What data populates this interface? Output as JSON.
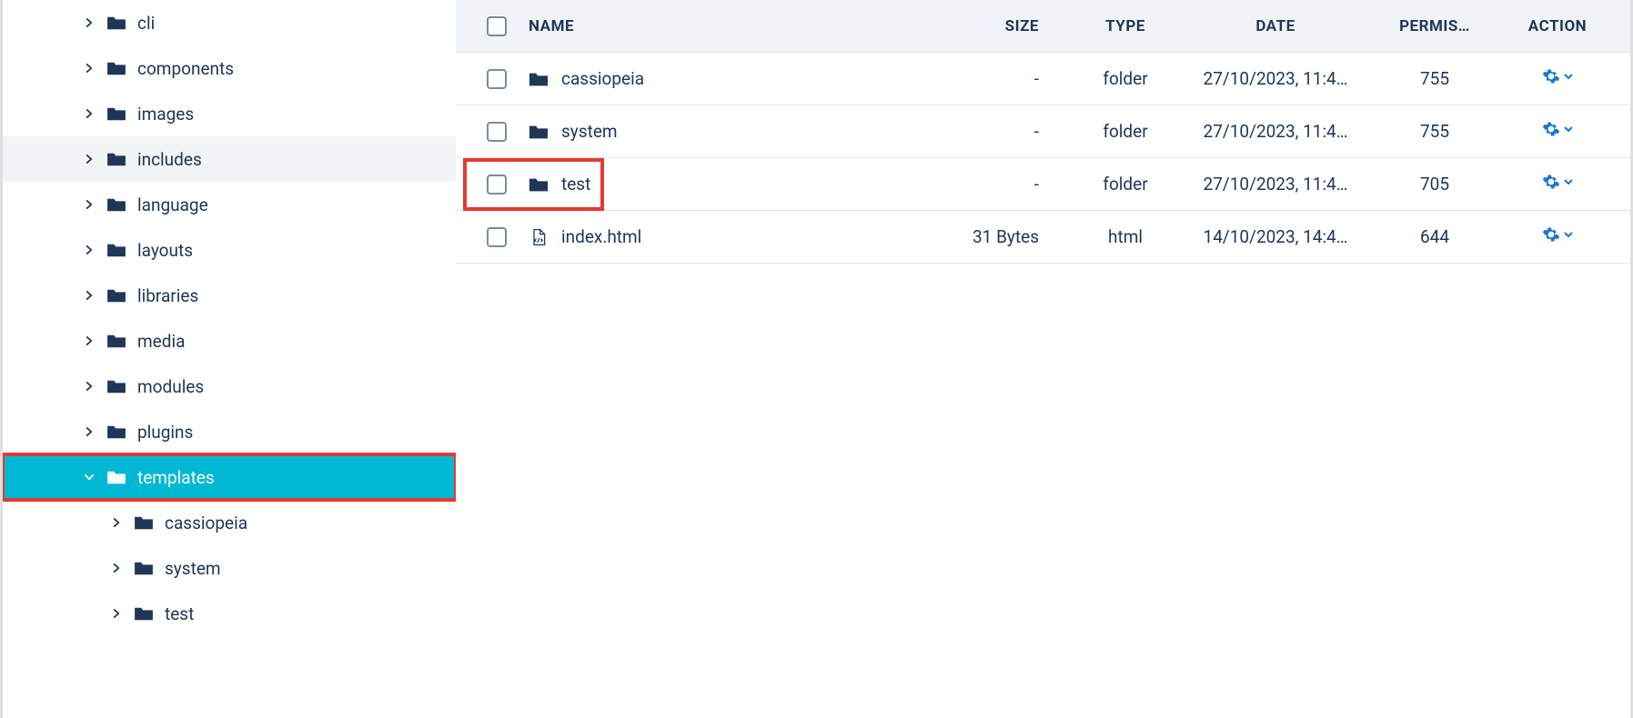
{
  "sidebar": {
    "items": [
      {
        "label": "cli",
        "level": 0,
        "expanded": false,
        "state": ""
      },
      {
        "label": "components",
        "level": 0,
        "expanded": false,
        "state": ""
      },
      {
        "label": "images",
        "level": 0,
        "expanded": false,
        "state": ""
      },
      {
        "label": "includes",
        "level": 0,
        "expanded": false,
        "state": "hovered"
      },
      {
        "label": "language",
        "level": 0,
        "expanded": false,
        "state": ""
      },
      {
        "label": "layouts",
        "level": 0,
        "expanded": false,
        "state": ""
      },
      {
        "label": "libraries",
        "level": 0,
        "expanded": false,
        "state": ""
      },
      {
        "label": "media",
        "level": 0,
        "expanded": false,
        "state": ""
      },
      {
        "label": "modules",
        "level": 0,
        "expanded": false,
        "state": ""
      },
      {
        "label": "plugins",
        "level": 0,
        "expanded": false,
        "state": ""
      },
      {
        "label": "templates",
        "level": 0,
        "expanded": true,
        "state": "selected",
        "highlight": true
      },
      {
        "label": "cassiopeia",
        "level": 1,
        "expanded": false,
        "state": ""
      },
      {
        "label": "system",
        "level": 1,
        "expanded": false,
        "state": ""
      },
      {
        "label": "test",
        "level": 1,
        "expanded": false,
        "state": ""
      }
    ]
  },
  "table": {
    "headers": {
      "name": "NAME",
      "size": "SIZE",
      "type": "TYPE",
      "date": "DATE",
      "permissions": "PERMIS…",
      "action": "ACTION"
    },
    "rows": [
      {
        "kind": "folder",
        "name": "cassiopeia",
        "size": "-",
        "type": "folder",
        "date": "27/10/2023, 11:4…",
        "permissions": "755",
        "highlight": false
      },
      {
        "kind": "folder",
        "name": "system",
        "size": "-",
        "type": "folder",
        "date": "27/10/2023, 11:4…",
        "permissions": "755",
        "highlight": false
      },
      {
        "kind": "folder",
        "name": "test",
        "size": "-",
        "type": "folder",
        "date": "27/10/2023, 11:4…",
        "permissions": "705",
        "highlight": true
      },
      {
        "kind": "file",
        "name": "index.html",
        "size": "31 Bytes",
        "type": "html",
        "date": "14/10/2023, 14:4…",
        "permissions": "644",
        "highlight": false
      }
    ]
  }
}
